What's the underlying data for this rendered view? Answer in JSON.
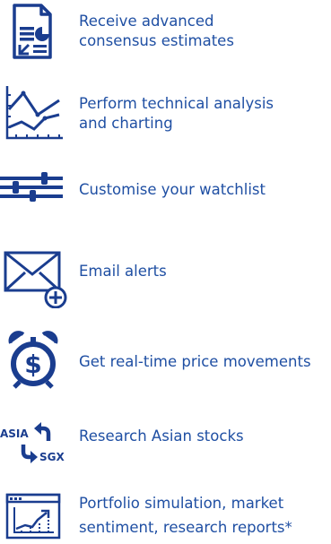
{
  "colors": {
    "icon": "#1a3d8f",
    "text": "#1f4fa3"
  },
  "features": [
    {
      "icon": "report-chart-icon",
      "label_lines": [
        "Receive advanced",
        "consensus estimates"
      ]
    },
    {
      "icon": "line-chart-icon",
      "label_lines": [
        "Perform technical analysis",
        "and charting"
      ]
    },
    {
      "icon": "sliders-icon",
      "label_lines": [
        "Customise your watchlist"
      ]
    },
    {
      "icon": "envelope-plus-icon",
      "label_lines": [
        "Email alerts"
      ]
    },
    {
      "icon": "dollar-alarm-clock-icon",
      "label_lines": [
        "Get real-time price movements"
      ]
    },
    {
      "icon": "asia-sgx-icon",
      "icon_text": [
        "ASIA",
        "SGX"
      ],
      "label_lines": [
        "Research Asian stocks"
      ]
    },
    {
      "icon": "portfolio-chart-window-icon",
      "label_lines": [
        "Portfolio simulation, market",
        "sentiment, research reports*"
      ]
    }
  ]
}
